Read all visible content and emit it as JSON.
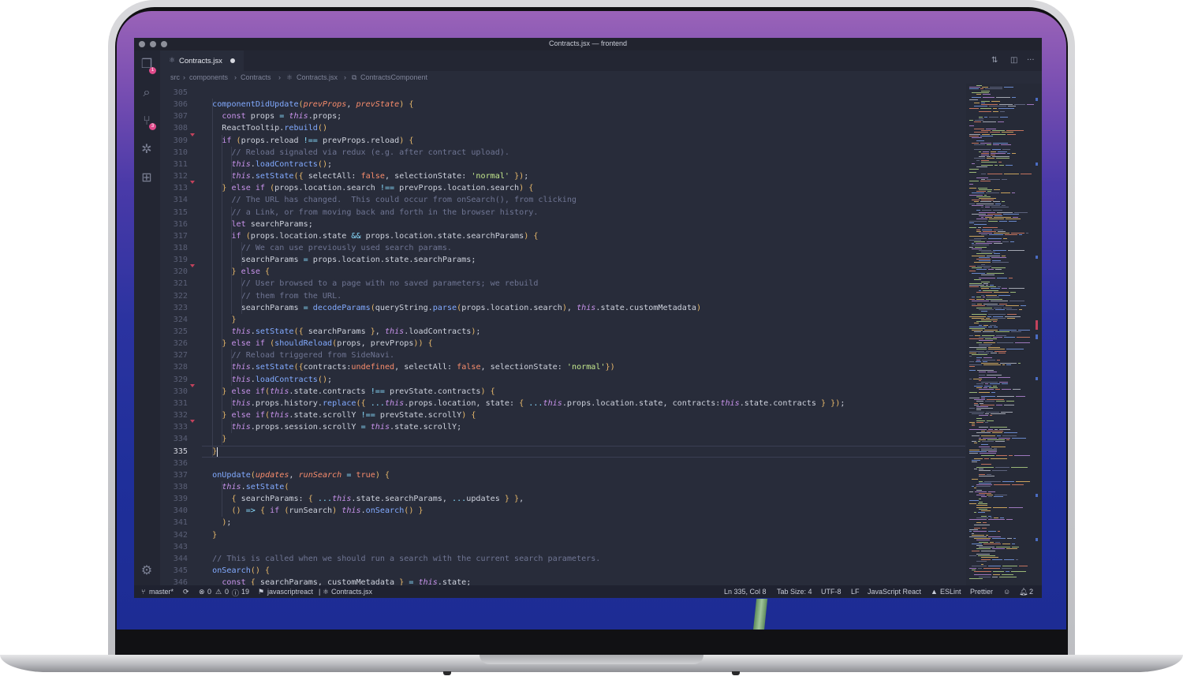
{
  "window": {
    "title": "Contracts.jsx — frontend"
  },
  "tab": {
    "label": "Contracts.jsx"
  },
  "breadcrumb": {
    "items": [
      "src",
      "components",
      "Contracts",
      "Contracts.jsx",
      "ContractsComponent"
    ]
  },
  "activity_bar": {
    "icons": [
      "files-icon",
      "search-icon",
      "source-control-icon",
      "debug-icon",
      "extensions-icon",
      "gear-icon"
    ],
    "badges": {
      "files": "1",
      "source_control": "3"
    }
  },
  "editor": {
    "current_line": 335,
    "lines": [
      {
        "n": "305",
        "text": ""
      },
      {
        "n": "306",
        "text": "  componentDidUpdate(prevProps, prevState) {"
      },
      {
        "n": "307",
        "text": "    const props = this.props;"
      },
      {
        "n": "308",
        "text": "    ReactTooltip.rebuild()"
      },
      {
        "n": "309",
        "text": "    if (props.reload !== prevProps.reload) {"
      },
      {
        "n": "310",
        "text": "      // Reload signaled via redux (e.g. after contract upload)."
      },
      {
        "n": "311",
        "text": "      this.loadContracts();"
      },
      {
        "n": "312",
        "text": "      this.setState({ selectAll: false, selectionState: 'normal' });"
      },
      {
        "n": "313",
        "text": "    } else if (props.location.search !== prevProps.location.search) {"
      },
      {
        "n": "314",
        "text": "      // The URL has changed.  This could occur from onSearch(), from clicking"
      },
      {
        "n": "315",
        "text": "      // a Link, or from moving back and forth in the browser history."
      },
      {
        "n": "316",
        "text": "      let searchParams;"
      },
      {
        "n": "317",
        "text": "      if (props.location.state && props.location.state.searchParams) {"
      },
      {
        "n": "318",
        "text": "        // We can use previously used search params."
      },
      {
        "n": "319",
        "text": "        searchParams = props.location.state.searchParams;"
      },
      {
        "n": "320",
        "text": "      } else {"
      },
      {
        "n": "321",
        "text": "        // User browsed to a page with no saved parameters; we rebuild"
      },
      {
        "n": "322",
        "text": "        // them from the URL."
      },
      {
        "n": "323",
        "text": "        searchParams = decodeParams(queryString.parse(props.location.search), this.state.customMetadata)"
      },
      {
        "n": "324",
        "text": "      }"
      },
      {
        "n": "325",
        "text": "      this.setState({ searchParams }, this.loadContracts);"
      },
      {
        "n": "326",
        "text": "    } else if (shouldReload(props, prevProps)) {"
      },
      {
        "n": "327",
        "text": "      // Reload triggered from SideNavi."
      },
      {
        "n": "328",
        "text": "      this.setState({contracts:undefined, selectAll: false, selectionState: 'normal'})"
      },
      {
        "n": "329",
        "text": "      this.loadContracts();"
      },
      {
        "n": "330",
        "text": "    } else if(this.state.contracts !== prevState.contracts) {"
      },
      {
        "n": "331",
        "text": "      this.props.history.replace({ ...this.props.location, state: { ...this.props.location.state, contracts:this.state.contracts } });"
      },
      {
        "n": "332",
        "text": "    } else if(this.state.scrollY !== prevState.scrollY) {"
      },
      {
        "n": "333",
        "text": "      this.props.session.scrollY = this.state.scrollY;"
      },
      {
        "n": "334",
        "text": "    }"
      },
      {
        "n": "335",
        "text": "  }"
      },
      {
        "n": "336",
        "text": ""
      },
      {
        "n": "337",
        "text": "  onUpdate(updates, runSearch = true) {"
      },
      {
        "n": "338",
        "text": "    this.setState("
      },
      {
        "n": "339",
        "text": "      { searchParams: { ...this.state.searchParams, ...updates } },"
      },
      {
        "n": "340",
        "text": "      () => { if (runSearch) this.onSearch() }"
      },
      {
        "n": "341",
        "text": "    );"
      },
      {
        "n": "342",
        "text": "  }"
      },
      {
        "n": "343",
        "text": ""
      },
      {
        "n": "344",
        "text": "  // This is called when we should run a search with the current search parameters."
      },
      {
        "n": "345",
        "text": "  onSearch() {"
      },
      {
        "n": "346",
        "text": "    const { searchParams, customMetadata } = this.state;"
      }
    ]
  },
  "status_bar": {
    "branch": "master*",
    "errors": "0",
    "warnings": "0",
    "infos": "19",
    "language_tag": "javascriptreact",
    "file": "Contracts.jsx",
    "position": "Ln 335, Col 8",
    "tab_size": "Tab Size: 4",
    "encoding": "UTF-8",
    "eol": "LF",
    "language": "JavaScript React",
    "eslint": "ESLint",
    "prettier": "Prettier",
    "notifications": "2"
  },
  "colors": {
    "editor_bg": "#282c3a",
    "keyword": "#c792ea",
    "function": "#82aaff",
    "string": "#c3e88d",
    "comment": "#6f7593",
    "parameter": "#f78c6c"
  }
}
